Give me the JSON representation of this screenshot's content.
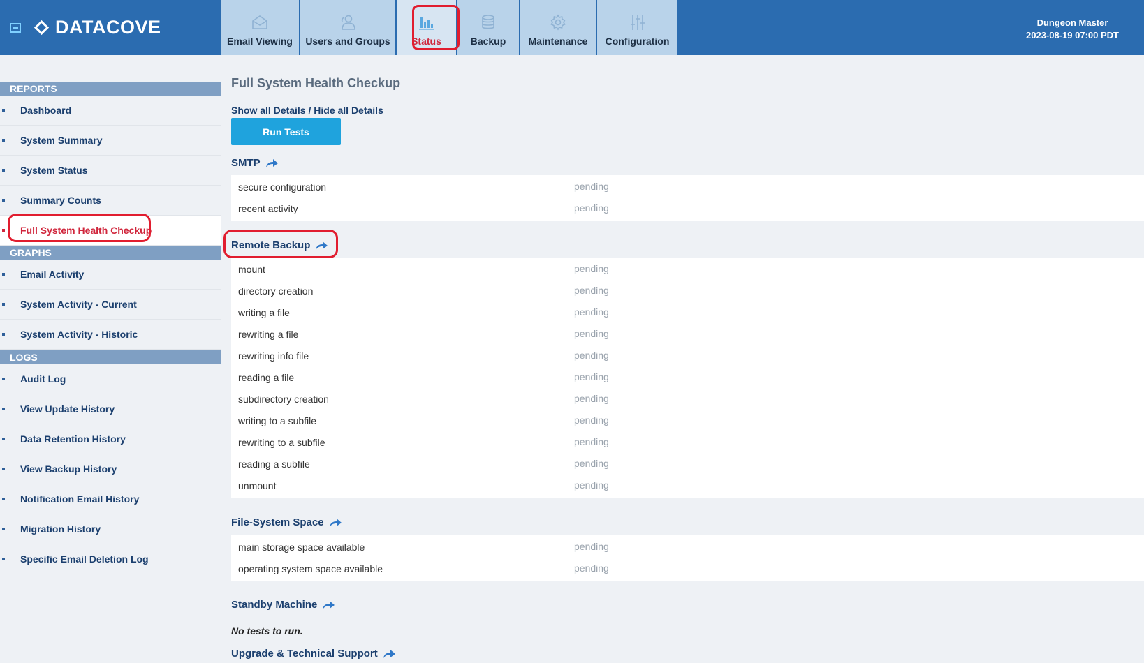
{
  "app": {
    "name": "DATACOVE"
  },
  "nav_tabs": [
    {
      "label": "Email Viewing",
      "icon": "envelope-icon"
    },
    {
      "label": "Users and Groups",
      "icon": "users-icon"
    },
    {
      "label": "Status",
      "icon": "bar-chart-icon",
      "active": true
    },
    {
      "label": "Backup",
      "icon": "database-icon"
    },
    {
      "label": "Maintenance",
      "icon": "gear-icon"
    },
    {
      "label": "Configuration",
      "icon": "sliders-icon"
    }
  ],
  "user": {
    "name": "Dungeon Master",
    "datetime": "2023-08-19 07:00 PDT"
  },
  "sidebar": {
    "reports_heading": "REPORTS",
    "reports": [
      "Dashboard",
      "System Summary",
      "System Status",
      "Summary Counts",
      "Full System Health Checkup"
    ],
    "graphs_heading": "GRAPHS",
    "graphs": [
      "Email Activity",
      "System Activity - Current",
      "System Activity - Historic"
    ],
    "logs_heading": "LOGS",
    "logs": [
      "Audit Log",
      "View Update History",
      "Data Retention History",
      "View Backup History",
      "Notification Email History",
      "Migration History",
      "Specific Email Deletion Log"
    ]
  },
  "main": {
    "title": "Full System Health Checkup",
    "show_all": "Show all Details",
    "separator": " / ",
    "hide_all": "Hide all Details",
    "run_button": "Run Tests",
    "sections": [
      {
        "name": "SMTP",
        "tests": [
          {
            "name": "secure configuration",
            "status": "pending"
          },
          {
            "name": "recent activity",
            "status": "pending"
          }
        ]
      },
      {
        "name": "Remote Backup",
        "tests": [
          {
            "name": "mount",
            "status": "pending"
          },
          {
            "name": "directory creation",
            "status": "pending"
          },
          {
            "name": "writing a file",
            "status": "pending"
          },
          {
            "name": "rewriting a file",
            "status": "pending"
          },
          {
            "name": "rewriting info file",
            "status": "pending"
          },
          {
            "name": "reading a file",
            "status": "pending"
          },
          {
            "name": "subdirectory creation",
            "status": "pending"
          },
          {
            "name": "writing to a subfile",
            "status": "pending"
          },
          {
            "name": "rewriting to a subfile",
            "status": "pending"
          },
          {
            "name": "reading a subfile",
            "status": "pending"
          },
          {
            "name": "unmount",
            "status": "pending"
          }
        ]
      },
      {
        "name": "File-System Space",
        "tests": [
          {
            "name": "main storage space available",
            "status": "pending"
          },
          {
            "name": "operating system space available",
            "status": "pending"
          }
        ]
      },
      {
        "name": "Standby Machine",
        "note": "No tests to run."
      },
      {
        "name": "Upgrade & Technical Support"
      }
    ]
  },
  "colors": {
    "header_bg": "#2b6cb0",
    "tab_bg": "#b9d3ea",
    "accent_red": "#d0263c",
    "button_blue": "#1fa3dd",
    "link_navy": "#1b3f6e"
  }
}
